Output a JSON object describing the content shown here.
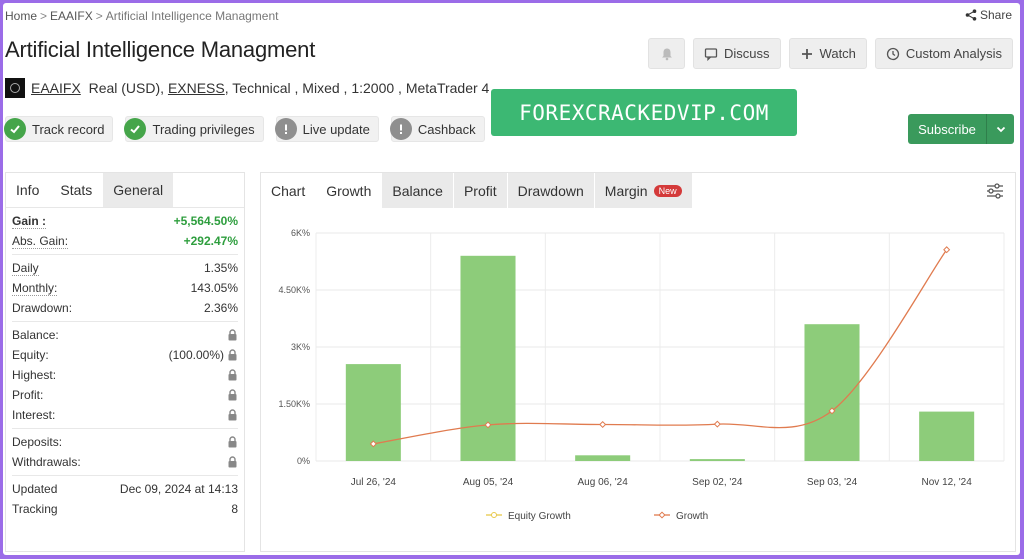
{
  "breadcrumb": {
    "home": "Home",
    "eaaifx": "EAAIFX",
    "current": "Artificial Intelligence Managment",
    "sep": ">"
  },
  "share_label": "Share",
  "page_title": "Artificial Intelligence Managment",
  "header_buttons": {
    "discuss": "Discuss",
    "watch": "Watch",
    "custom_analysis": "Custom Analysis"
  },
  "meta": {
    "user": "EAAIFX",
    "account": "Real (USD),",
    "broker": "EXNESS",
    "rest": ", Technical , Mixed , 1:2000 , MetaTrader 4"
  },
  "badges": [
    {
      "label": "Track record",
      "status": "ok"
    },
    {
      "label": "Trading privileges",
      "status": "ok"
    },
    {
      "label": "Live update",
      "status": "warn"
    },
    {
      "label": "Cashback",
      "status": "warn"
    }
  ],
  "watermark": "FOREXCRACKEDVIP.COM",
  "subscribe_label": "Subscribe",
  "left_tabs": [
    "Info",
    "Stats",
    "General"
  ],
  "stats": {
    "gain_label": "Gain :",
    "gain_value": "+5,564.50%",
    "abs_gain_label": "Abs. Gain:",
    "abs_gain_value": "+292.47%",
    "daily_label": "Daily",
    "daily_value": "1.35%",
    "monthly_label": "Monthly:",
    "monthly_value": "143.05%",
    "drawdown_label": "Drawdown:",
    "drawdown_value": "2.36%",
    "balance_label": "Balance:",
    "equity_label": "Equity:",
    "equity_value": "(100.00%)",
    "highest_label": "Highest:",
    "profit_label": "Profit:",
    "interest_label": "Interest:",
    "deposits_label": "Deposits:",
    "withdrawals_label": "Withdrawals:",
    "updated_label": "Updated",
    "updated_value": "Dec 09, 2024 at 14:13",
    "tracking_label": "Tracking",
    "tracking_value": "8"
  },
  "right_tabs": {
    "chart": "Chart",
    "growth": "Growth",
    "balance": "Balance",
    "profit": "Profit",
    "drawdown": "Drawdown",
    "margin": "Margin",
    "new_badge": "New"
  },
  "colors": {
    "accent_green": "#3a9a5c",
    "bar_green": "#8dcc7a",
    "line_orange": "#e07b4f",
    "equity_yellow": "#e8c84a"
  },
  "chart_data": {
    "type": "bar",
    "categories": [
      "Jul 26, '24",
      "Aug 05, '24",
      "Aug 06, '24",
      "Sep 02, '24",
      "Sep 03, '24",
      "Nov 12, '24"
    ],
    "y_ticks": [
      "0%",
      "1.50K%",
      "3K%",
      "4.50K%",
      "6K%"
    ],
    "ylim": [
      0,
      6000
    ],
    "series": [
      {
        "name": "Equity Growth",
        "type": "line",
        "values": []
      },
      {
        "name": "Growth",
        "type": "bar",
        "values": [
          2550,
          5400,
          150,
          50,
          3600,
          1300
        ]
      },
      {
        "name": "Growth",
        "type": "line",
        "values": [
          450,
          950,
          960,
          970,
          1320,
          5560
        ]
      }
    ],
    "legend": {
      "equity": "Equity Growth",
      "growth": "Growth",
      "position": "bottom"
    },
    "grid": true
  }
}
